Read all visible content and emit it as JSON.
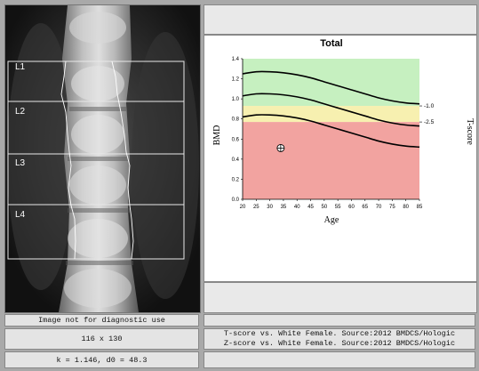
{
  "scan": {
    "vertebra_labels": [
      "L1",
      "L2",
      "L3",
      "L4"
    ]
  },
  "footer": {
    "disclaimer": "Image not for diagnostic use",
    "matrix": "116 x 130",
    "params": "k = 1.146, d0 = 48.3",
    "tscore_ref": "T-score vs. White Female. Source:2012 BMDCS/Hologic",
    "zscore_ref": "Z-score vs. White Female. Source:2012 BMDCS/Hologic"
  },
  "chart_data": {
    "type": "line",
    "title": "Total",
    "xlabel": "Age",
    "ylabel": "BMD",
    "y2label": "T-score",
    "xlim": [
      20,
      85
    ],
    "ylim": [
      0.0,
      1.4
    ],
    "x_ticks": [
      "20",
      "25",
      "30",
      "35",
      "40",
      "45",
      "50",
      "55",
      "60",
      "65",
      "70",
      "75",
      "80",
      "85"
    ],
    "y_ticks": [
      "0.0",
      "0.2",
      "0.4",
      "0.6",
      "0.8",
      "1.0",
      "1.2",
      "1.4"
    ],
    "tscore_ticks": [
      {
        "label": "-1.0",
        "bmd": 0.93
      },
      {
        "label": "-2.5",
        "bmd": 0.77
      }
    ],
    "zones": [
      {
        "name": "normal",
        "from": 0.93,
        "to": 1.4,
        "color": "#c6f0c0"
      },
      {
        "name": "osteopenia",
        "from": 0.77,
        "to": 0.93,
        "color": "#f7f0b0"
      },
      {
        "name": "osteoporosis",
        "from": 0.0,
        "to": 0.77,
        "color": "#f2a3a0"
      }
    ],
    "x": [
      20,
      25,
      30,
      35,
      40,
      45,
      50,
      55,
      60,
      65,
      70,
      75,
      80,
      85
    ],
    "series": [
      {
        "values": [
          1.25,
          1.27,
          1.27,
          1.26,
          1.24,
          1.21,
          1.17,
          1.13,
          1.09,
          1.05,
          1.01,
          0.98,
          0.96,
          0.95
        ]
      },
      {
        "values": [
          1.03,
          1.05,
          1.05,
          1.04,
          1.02,
          0.99,
          0.95,
          0.91,
          0.87,
          0.83,
          0.79,
          0.76,
          0.74,
          0.73
        ]
      },
      {
        "values": [
          0.82,
          0.84,
          0.84,
          0.83,
          0.81,
          0.78,
          0.74,
          0.7,
          0.66,
          0.62,
          0.58,
          0.55,
          0.53,
          0.52
        ]
      }
    ],
    "patient_point": {
      "x": 34,
      "y": 0.51
    },
    "grid": false,
    "legend": "none"
  }
}
